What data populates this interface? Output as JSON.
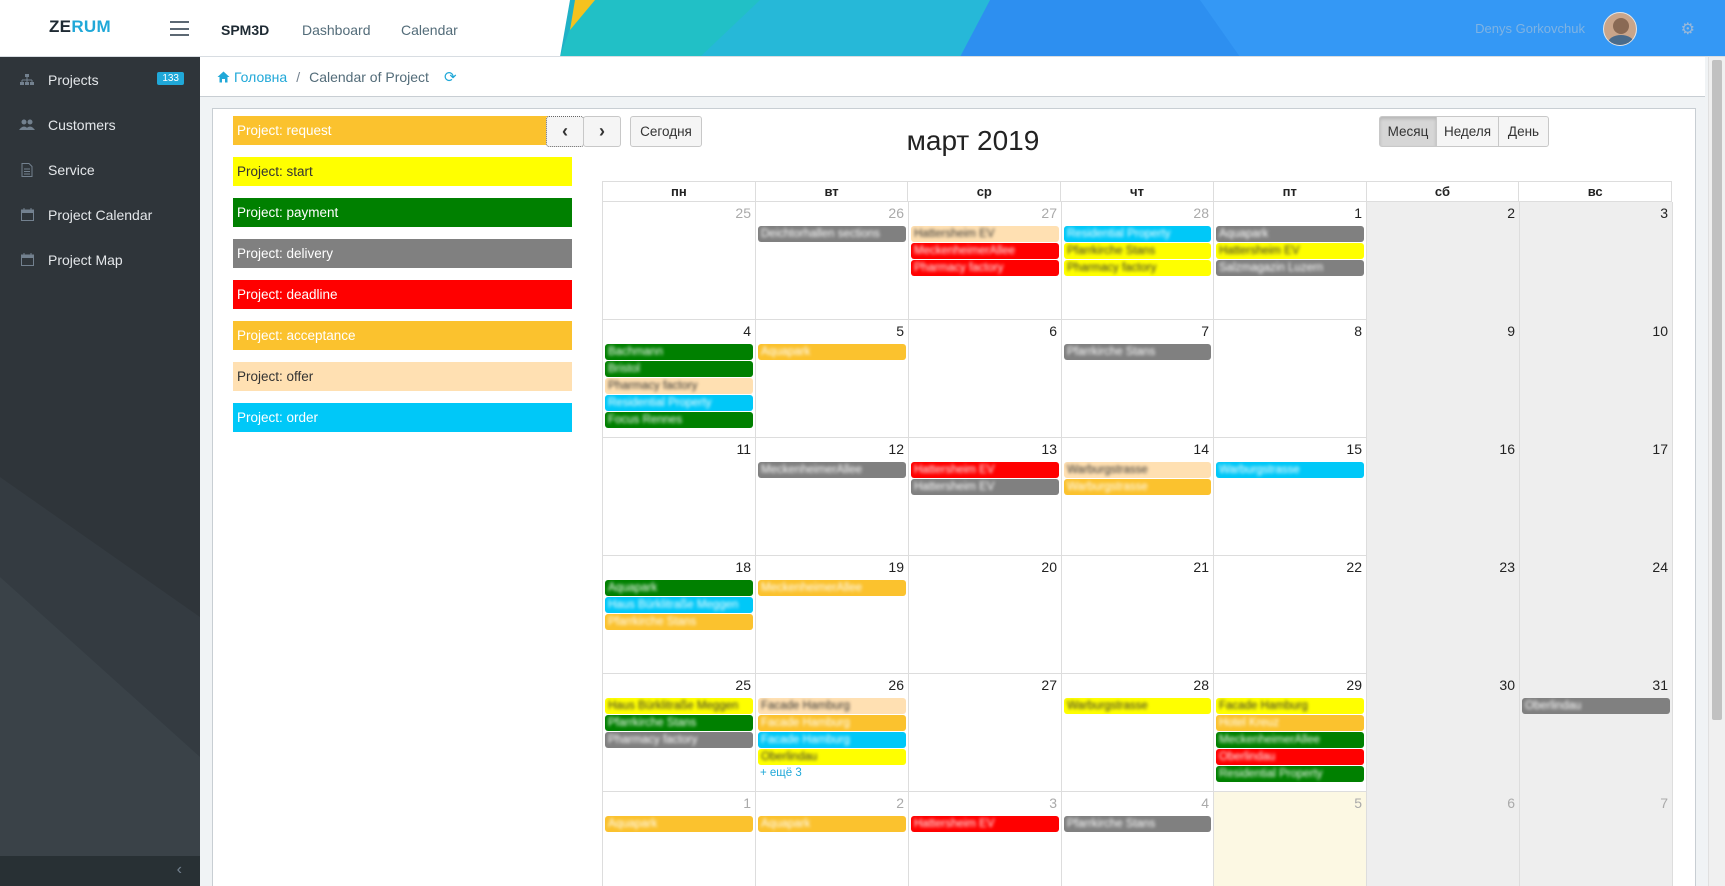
{
  "topbar": {
    "brand_main": "ZE",
    "brand_accent": "RUM",
    "nav": [
      "SPM3D",
      "Dashboard",
      "Calendar"
    ],
    "user_name": "Denys Gorkovchuk"
  },
  "sidebar": {
    "items": [
      {
        "label": "Projects",
        "icon": "sitemap-icon",
        "badge": "133"
      },
      {
        "label": "Customers",
        "icon": "users-icon"
      },
      {
        "label": "Service",
        "icon": "document-icon"
      },
      {
        "label": "Project Calendar",
        "icon": "calendar-icon"
      },
      {
        "label": "Project Map",
        "icon": "calendar-icon"
      }
    ]
  },
  "breadcrumb": {
    "home": "Головна",
    "current": "Calendar of Project"
  },
  "legend": [
    {
      "label": "Project: request",
      "color": "#fbc22e",
      "text": "#ffffff"
    },
    {
      "label": "Project: start",
      "color": "#ffff00",
      "text": "#333333"
    },
    {
      "label": "Project: payment",
      "color": "#008000",
      "text": "#ffffff"
    },
    {
      "label": "Project: delivery",
      "color": "#808080",
      "text": "#ffffff"
    },
    {
      "label": "Project: deadline",
      "color": "#ff0000",
      "text": "#ffffff"
    },
    {
      "label": "Project: acceptance",
      "color": "#fbc22e",
      "text": "#ffffff"
    },
    {
      "label": "Project: offer",
      "color": "#ffe0b2",
      "text": "#333333"
    },
    {
      "label": "Project: order",
      "color": "#00c8f8",
      "text": "#ffffff"
    }
  ],
  "calendar": {
    "title": "март 2019",
    "today_label": "Сегодня",
    "views": [
      "Месяц",
      "Неделя",
      "День"
    ],
    "active_view": "Месяц",
    "weekdays": [
      "пн",
      "вт",
      "ср",
      "чт",
      "пт",
      "сб",
      "вс"
    ],
    "more_label": "+ ещё 3",
    "weeks": [
      [
        {
          "n": "25",
          "other": true,
          "ev": []
        },
        {
          "n": "26",
          "other": true,
          "ev": [
            {
              "t": "Deichtorhallen sections",
              "c": "delivery"
            }
          ]
        },
        {
          "n": "27",
          "other": true,
          "ev": [
            {
              "t": "Hattersheim EV",
              "c": "offer"
            },
            {
              "t": "MeckenheimerAllee",
              "c": "deadline"
            },
            {
              "t": "Pharmacy factory",
              "c": "deadline"
            }
          ]
        },
        {
          "n": "28",
          "other": true,
          "ev": [
            {
              "t": "Residential Property",
              "c": "order"
            },
            {
              "t": "Pfarrkirche Stans",
              "c": "start"
            },
            {
              "t": "Pharmacy factory",
              "c": "start"
            }
          ]
        },
        {
          "n": "1",
          "ev": [
            {
              "t": "Aquapark",
              "c": "delivery"
            },
            {
              "t": "Hattersheim EV",
              "c": "start"
            },
            {
              "t": "Salzmagazin Luzern",
              "c": "delivery"
            }
          ]
        },
        {
          "n": "2",
          "weekend": true,
          "ev": []
        },
        {
          "n": "3",
          "weekend": true,
          "ev": []
        }
      ],
      [
        {
          "n": "4",
          "ev": [
            {
              "t": "Bachmann",
              "c": "payment"
            },
            {
              "t": "Bristol",
              "c": "payment"
            },
            {
              "t": "Pharmacy factory",
              "c": "offer"
            },
            {
              "t": "Residential Property",
              "c": "order"
            },
            {
              "t": "Focus Rennes",
              "c": "payment"
            }
          ]
        },
        {
          "n": "5",
          "ev": [
            {
              "t": "Aquapark",
              "c": "request"
            }
          ]
        },
        {
          "n": "6",
          "ev": []
        },
        {
          "n": "7",
          "ev": [
            {
              "t": "Pfarrkirche Stans",
              "c": "delivery"
            }
          ]
        },
        {
          "n": "8",
          "ev": []
        },
        {
          "n": "9",
          "weekend": true,
          "ev": []
        },
        {
          "n": "10",
          "weekend": true,
          "ev": []
        }
      ],
      [
        {
          "n": "11",
          "ev": []
        },
        {
          "n": "12",
          "ev": [
            {
              "t": "MeckenheimerAllee",
              "c": "delivery"
            }
          ]
        },
        {
          "n": "13",
          "ev": [
            {
              "t": "Hattersheim EV",
              "c": "deadline"
            },
            {
              "t": "Hattersheim EV",
              "c": "delivery"
            }
          ]
        },
        {
          "n": "14",
          "ev": [
            {
              "t": "Warburgstrasse",
              "c": "offer"
            },
            {
              "t": "Warburgstrasse",
              "c": "request"
            }
          ]
        },
        {
          "n": "15",
          "ev": [
            {
              "t": "Warburgstrasse",
              "c": "order"
            }
          ]
        },
        {
          "n": "16",
          "weekend": true,
          "ev": []
        },
        {
          "n": "17",
          "weekend": true,
          "ev": []
        }
      ],
      [
        {
          "n": "18",
          "ev": [
            {
              "t": "Aquapark",
              "c": "payment"
            },
            {
              "t": "Haus Bürklitraße Meggen",
              "c": "order"
            },
            {
              "t": "Pfarrkirche Stans",
              "c": "request"
            }
          ]
        },
        {
          "n": "19",
          "ev": [
            {
              "t": "MeckenheimerAllee",
              "c": "request"
            }
          ]
        },
        {
          "n": "20",
          "ev": []
        },
        {
          "n": "21",
          "ev": []
        },
        {
          "n": "22",
          "ev": []
        },
        {
          "n": "23",
          "weekend": true,
          "ev": []
        },
        {
          "n": "24",
          "weekend": true,
          "ev": []
        }
      ],
      [
        {
          "n": "25",
          "ev": [
            {
              "t": "Haus Bürklitraße Meggen",
              "c": "start"
            },
            {
              "t": "Pfarrkirche Stans",
              "c": "payment"
            },
            {
              "t": "Pharmacy factory",
              "c": "delivery"
            }
          ]
        },
        {
          "n": "26",
          "ev": [
            {
              "t": "Facade Hamburg",
              "c": "offer"
            },
            {
              "t": "Facade Hamburg",
              "c": "request"
            },
            {
              "t": "Facade Hamburg",
              "c": "order"
            },
            {
              "t": "Oberlindau",
              "c": "start"
            }
          ],
          "more": true
        },
        {
          "n": "27",
          "ev": []
        },
        {
          "n": "28",
          "ev": [
            {
              "t": "Warburgstrasse",
              "c": "start"
            }
          ]
        },
        {
          "n": "29",
          "ev": [
            {
              "t": "Facade Hamburg",
              "c": "start"
            },
            {
              "t": "Hotel Kreuz",
              "c": "request"
            },
            {
              "t": "MeckenheimerAllee",
              "c": "payment"
            },
            {
              "t": "Oberlindau",
              "c": "deadline"
            },
            {
              "t": "Residential Property",
              "c": "payment"
            }
          ]
        },
        {
          "n": "30",
          "weekend": true,
          "ev": []
        },
        {
          "n": "31",
          "weekend": true,
          "ev": [
            {
              "t": "Oberlindau",
              "c": "delivery"
            }
          ]
        }
      ],
      [
        {
          "n": "1",
          "other": true,
          "ev": [
            {
              "t": "Aquapark",
              "c": "request"
            }
          ]
        },
        {
          "n": "2",
          "other": true,
          "ev": [
            {
              "t": "Aquapark",
              "c": "request"
            }
          ]
        },
        {
          "n": "3",
          "other": true,
          "ev": [
            {
              "t": "Hattersheim EV",
              "c": "deadline"
            }
          ]
        },
        {
          "n": "4",
          "other": true,
          "ev": [
            {
              "t": "Pfarrkirche Stans",
              "c": "delivery"
            }
          ]
        },
        {
          "n": "5",
          "other": true,
          "today": true,
          "ev": []
        },
        {
          "n": "6",
          "other": true,
          "weekend": true,
          "ev": []
        },
        {
          "n": "7",
          "other": true,
          "weekend": true,
          "ev": []
        }
      ]
    ]
  },
  "colors": {
    "request": "#fbc22e",
    "start": "#ffff00",
    "payment": "#008000",
    "delivery": "#808080",
    "deadline": "#ff0000",
    "acceptance": "#fbc22e",
    "offer": "#ffe0b2",
    "order": "#00c8f8"
  }
}
